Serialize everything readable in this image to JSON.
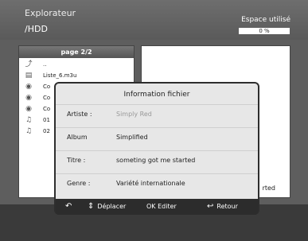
{
  "header": {
    "app_title": "Explorateur",
    "path": "/HDD",
    "space_label": "Espace utilisé",
    "space_value": "0 %"
  },
  "left_pane": {
    "page_label": "page 2/2",
    "items": [
      {
        "icon": "up-folder-icon",
        "label": ".."
      },
      {
        "icon": "playlist-icon",
        "label": "Liste_6.m3u"
      },
      {
        "icon": "cd-icon",
        "label": "Co"
      },
      {
        "icon": "cd-icon",
        "label": "Co"
      },
      {
        "icon": "cd-icon",
        "label": "Co"
      },
      {
        "icon": "music-note-icon",
        "label": "01"
      },
      {
        "icon": "music-note-icon",
        "label": "02"
      }
    ]
  },
  "right_pane": {
    "partial_text": "rted"
  },
  "dialog": {
    "title": "Information fichier",
    "rows": [
      {
        "key": "Artiste :",
        "value": "Simply Red",
        "muted": true
      },
      {
        "key": "Album",
        "value": "Simplified",
        "muted": false
      },
      {
        "key": "Titre :",
        "value": "someting got me started",
        "muted": false
      },
      {
        "key": "Genre :",
        "value": "Variété internationale",
        "muted": false
      }
    ],
    "footer": {
      "back_glyph": "back-arrow-icon",
      "move_label": "Déplacer",
      "edit_label": "OK Editer",
      "return_label": "Retour"
    }
  }
}
